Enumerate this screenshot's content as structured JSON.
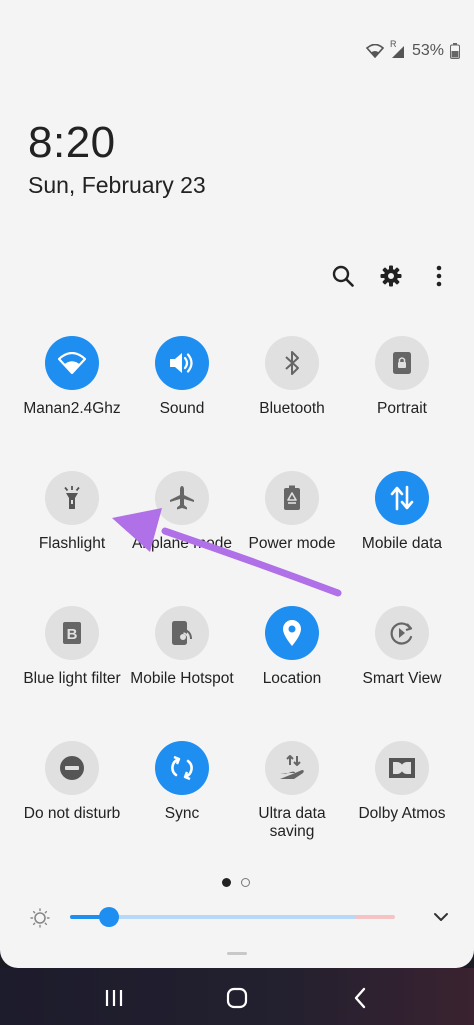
{
  "status": {
    "signal_label": "R",
    "battery": "53%"
  },
  "clock": {
    "time": "8:20",
    "date": "Sun, February 23"
  },
  "toolbar": {
    "search_icon": "search-icon",
    "settings_icon": "gear-icon",
    "more_icon": "more-vert-icon"
  },
  "tiles": [
    {
      "label": "Manan2.4Ghz",
      "on": true,
      "icon": "wifi-icon"
    },
    {
      "label": "Sound",
      "on": true,
      "icon": "volume-icon"
    },
    {
      "label": "Bluetooth",
      "on": false,
      "icon": "bluetooth-icon"
    },
    {
      "label": "Portrait",
      "on": false,
      "icon": "portrait-lock-icon"
    },
    {
      "label": "Flashlight",
      "on": false,
      "icon": "flashlight-icon"
    },
    {
      "label": "Airplane mode",
      "on": false,
      "icon": "airplane-icon"
    },
    {
      "label": "Power mode",
      "on": false,
      "icon": "battery-recycle-icon"
    },
    {
      "label": "Mobile data",
      "on": true,
      "icon": "mobile-data-icon"
    },
    {
      "label": "Blue light filter",
      "on": false,
      "icon": "blue-light-filter-icon"
    },
    {
      "label": "Mobile Hotspot",
      "on": false,
      "icon": "hotspot-icon"
    },
    {
      "label": "Location",
      "on": true,
      "icon": "location-pin-icon"
    },
    {
      "label": "Smart View",
      "on": false,
      "icon": "smart-view-icon"
    },
    {
      "label": "Do not disturb",
      "on": false,
      "icon": "do-not-disturb-icon"
    },
    {
      "label": "Sync",
      "on": true,
      "icon": "sync-icon"
    },
    {
      "label": "Ultra data saving",
      "on": false,
      "icon": "data-saving-icon"
    },
    {
      "label": "Dolby Atmos",
      "on": false,
      "icon": "dolby-icon"
    }
  ],
  "pager": {
    "current": 1,
    "total": 2
  },
  "brightness": {
    "level": 0.09
  },
  "colors": {
    "accent": "#1e8ef0",
    "annotation_arrow": "#b070e8"
  }
}
